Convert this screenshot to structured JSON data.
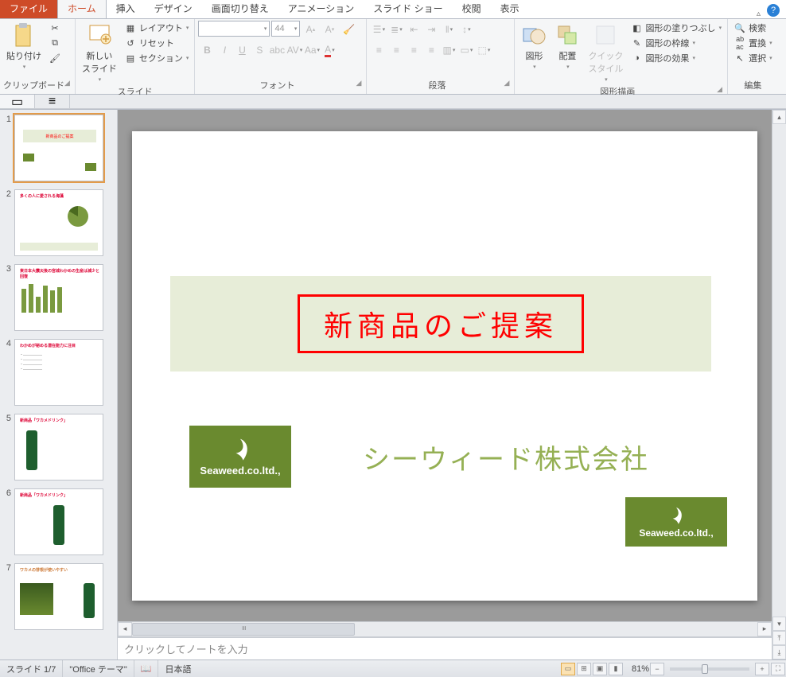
{
  "tabs": {
    "file": "ファイル",
    "home": "ホーム",
    "insert": "挿入",
    "design": "デザイン",
    "transitions": "画面切り替え",
    "animations": "アニメーション",
    "slideshow": "スライド ショー",
    "review": "校閲",
    "view": "表示"
  },
  "ribbon": {
    "clipboard": {
      "label": "クリップボード",
      "paste": "貼り付け"
    },
    "slides": {
      "label": "スライド",
      "new_slide": "新しい\nスライド",
      "layout": "レイアウト",
      "reset": "リセット",
      "section": "セクション"
    },
    "font": {
      "label": "フォント",
      "size_placeholder": "44"
    },
    "paragraph": {
      "label": "段落"
    },
    "drawing": {
      "label": "図形描画",
      "shapes": "図形",
      "arrange": "配置",
      "quickstyle": "クイック\nスタイル",
      "fill": "図形の塗りつぶし",
      "outline": "図形の枠線",
      "effects": "図形の効果"
    },
    "editing": {
      "label": "編集",
      "find": "検索",
      "replace": "置換",
      "select": "選択"
    }
  },
  "slide": {
    "title": "新商品のご提案",
    "company": "シーウィード株式会社",
    "logo_text": "Seaweed.co.ltd.,"
  },
  "thumbs": {
    "t1": "新商品のご提案",
    "t2": "多くの人に愛される海藻",
    "t3": "東日本大震災後の宮城わかめの生産は減少と回復",
    "t4": "わかめが秘める潜在能力に注目",
    "t5": "新商品「ワカメドリンク」",
    "t6": "新商品「ワカメドリンク」",
    "t7": "ワカメの芽根が使いやすい"
  },
  "notes_placeholder": "クリックしてノートを入力",
  "status": {
    "slide_pos": "スライド 1/7",
    "theme": "\"Office テーマ\"",
    "lang": "日本語",
    "zoom": "81%"
  }
}
